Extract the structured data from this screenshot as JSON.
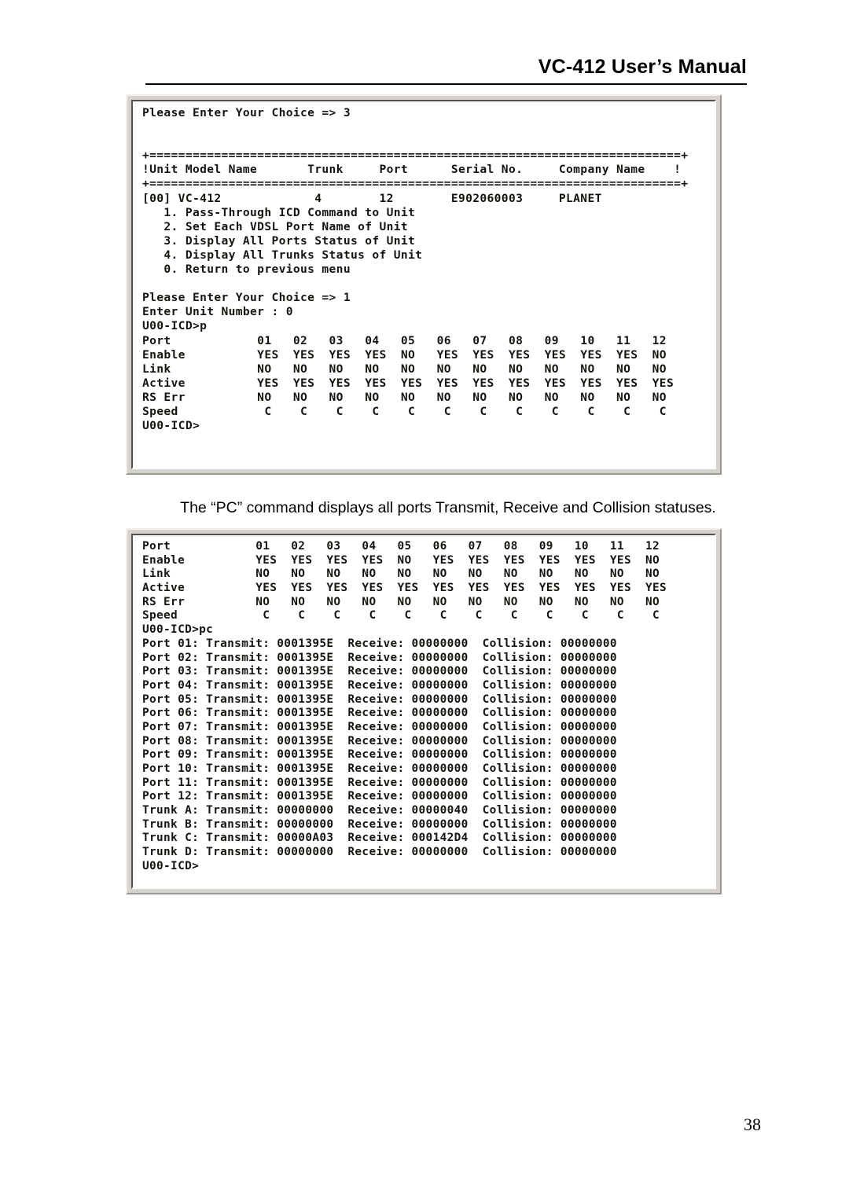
{
  "header": {
    "title": "VC-412 User’s Manual"
  },
  "caption": {
    "text": "The “PC” command displays all ports Transmit, Receive and Collision statuses."
  },
  "page_number": "38",
  "screenshot_one": {
    "name": "vc-412-console-unit-menu",
    "lines": [
      "Please Enter Your Choice => 3",
      "",
      "",
      "+==========================================================================+",
      "!Unit Model Name       Trunk     Port      Serial No.     Company Name    !",
      "+==========================================================================+",
      "[00] VC-412             4        12        E902060003     PLANET",
      "   1. Pass-Through ICD Command to Unit",
      "   2. Set Each VDSL Port Name of Unit",
      "   3. Display All Ports Status of Unit",
      "   4. Display All Trunks Status of Unit",
      "   0. Return to previous menu",
      "",
      "Please Enter Your Choice => 1",
      "Enter Unit Number : 0",
      "U00-ICD>p",
      "Port            01   02   03   04   05   06   07   08   09   10   11   12",
      "Enable          YES  YES  YES  YES  NO   YES  YES  YES  YES  YES  YES  NO",
      "Link            NO   NO   NO   NO   NO   NO   NO   NO   NO   NO   NO   NO",
      "Active          YES  YES  YES  YES  YES  YES  YES  YES  YES  YES  YES  YES",
      "RS Err          NO   NO   NO   NO   NO   NO   NO   NO   NO   NO   NO   NO",
      "Speed            C    C    C    C    C    C    C    C    C    C    C    C",
      "U00-ICD>"
    ]
  },
  "screenshot_two": {
    "name": "vc-412-console-pc-statistics",
    "lines": [
      "Port            01   02   03   04   05   06   07   08   09   10   11   12",
      "Enable          YES  YES  YES  YES  NO   YES  YES  YES  YES  YES  YES  NO",
      "Link            NO   NO   NO   NO   NO   NO   NO   NO   NO   NO   NO   NO",
      "Active          YES  YES  YES  YES  YES  YES  YES  YES  YES  YES  YES  YES",
      "RS Err          NO   NO   NO   NO   NO   NO   NO   NO   NO   NO   NO   NO",
      "Speed            C    C    C    C    C    C    C    C    C    C    C    C",
      "U00-ICD>pc",
      "Port 01: Transmit: 0001395E  Receive: 00000000  Collision: 00000000",
      "Port 02: Transmit: 0001395E  Receive: 00000000  Collision: 00000000",
      "Port 03: Transmit: 0001395E  Receive: 00000000  Collision: 00000000",
      "Port 04: Transmit: 0001395E  Receive: 00000000  Collision: 00000000",
      "Port 05: Transmit: 0001395E  Receive: 00000000  Collision: 00000000",
      "Port 06: Transmit: 0001395E  Receive: 00000000  Collision: 00000000",
      "Port 07: Transmit: 0001395E  Receive: 00000000  Collision: 00000000",
      "Port 08: Transmit: 0001395E  Receive: 00000000  Collision: 00000000",
      "Port 09: Transmit: 0001395E  Receive: 00000000  Collision: 00000000",
      "Port 10: Transmit: 0001395E  Receive: 00000000  Collision: 00000000",
      "Port 11: Transmit: 0001395E  Receive: 00000000  Collision: 00000000",
      "Port 12: Transmit: 0001395E  Receive: 00000000  Collision: 00000000",
      "Trunk A: Transmit: 00000000  Receive: 00000040  Collision: 00000000",
      "Trunk B: Transmit: 00000000  Receive: 00000000  Collision: 00000000",
      "Trunk C: Transmit: 00000A03  Receive: 000142D4  Collision: 00000000",
      "Trunk D: Transmit: 00000000  Receive: 00000000  Collision: 00000000",
      "U00-ICD>"
    ]
  }
}
